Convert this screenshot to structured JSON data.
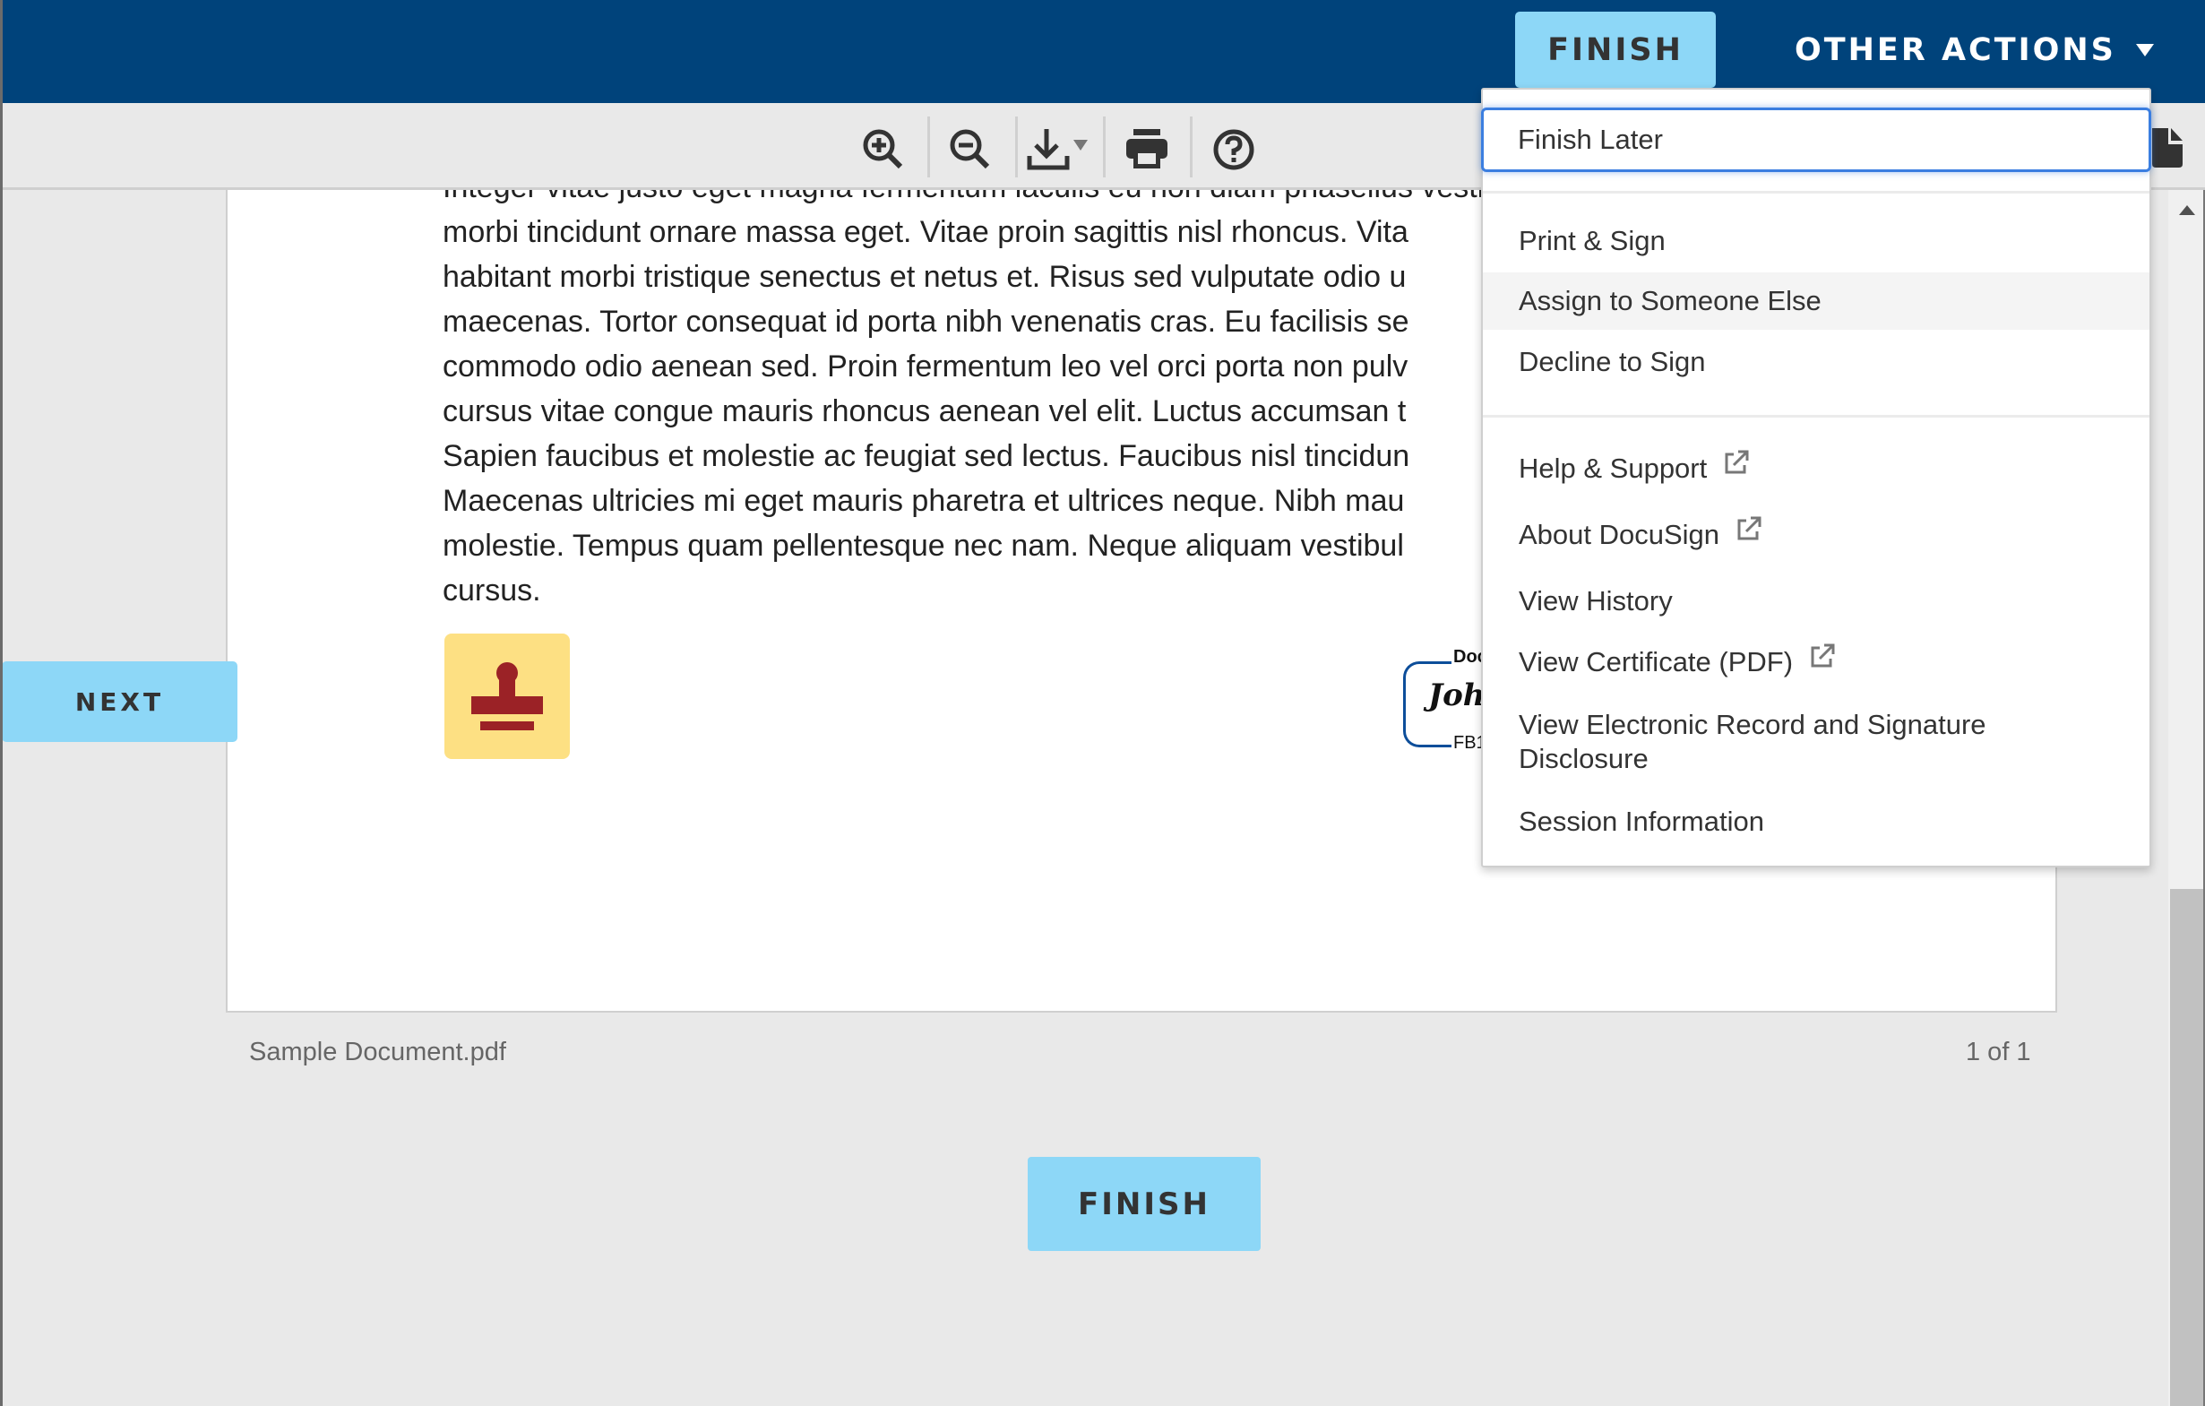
{
  "header": {
    "finish_label": "FINISH",
    "other_actions_label": "OTHER ACTIONS",
    "brand_color": "#00437b",
    "button_color": "#8dd7f7"
  },
  "toolbar": {
    "icons": [
      "zoom-in-icon",
      "zoom-out-icon",
      "download-icon",
      "print-icon",
      "help-icon",
      "document-icon"
    ]
  },
  "document": {
    "lines": [
      "Integer vitae justo eget magna fermentum iaculis eu non diam phasellus vestibulum.",
      "morbi tincidunt ornare massa eget. Vitae proin sagittis nisl rhoncus. Vita",
      "habitant morbi tristique senectus et netus et. Risus sed vulputate odio u",
      "maecenas. Tortor consequat id porta nibh venenatis cras. Eu facilisis se",
      "commodo odio aenean sed. Proin fermentum leo vel orci porta non pulv",
      "cursus vitae congue mauris rhoncus aenean vel elit. Luctus accumsan t",
      "Sapien faucibus et molestie ac feugiat sed lectus. Faucibus nisl tincidun",
      "Maecenas ultricies mi eget mauris pharetra et ultrices neque. Nibh mau",
      "molestie. Tempus quam pellentesque nec nam. Neque aliquam vestibul",
      "cursus."
    ],
    "signature": {
      "header": "Doc",
      "name": "John",
      "id": "FB1"
    },
    "file_name": "Sample Document.pdf",
    "page_indicator": "1 of 1"
  },
  "navigation": {
    "next_label": "NEXT",
    "finish_label": "FINISH"
  },
  "menu": {
    "items": [
      {
        "label": "Finish Later",
        "external": false,
        "state": "focused"
      },
      {
        "label": "Print & Sign",
        "external": false,
        "state": "normal"
      },
      {
        "label": "Assign to Someone Else",
        "external": false,
        "state": "hovered"
      },
      {
        "label": "Decline to Sign",
        "external": false,
        "state": "normal"
      },
      {
        "label": "Help & Support",
        "external": true,
        "state": "normal"
      },
      {
        "label": "About DocuSign",
        "external": true,
        "state": "normal"
      },
      {
        "label": "View History",
        "external": false,
        "state": "normal"
      },
      {
        "label": "View Certificate (PDF)",
        "external": true,
        "state": "normal"
      },
      {
        "label": "View Electronic Record and Signature Disclosure",
        "external": false,
        "state": "normal"
      },
      {
        "label": "Session Information",
        "external": false,
        "state": "normal"
      }
    ]
  }
}
